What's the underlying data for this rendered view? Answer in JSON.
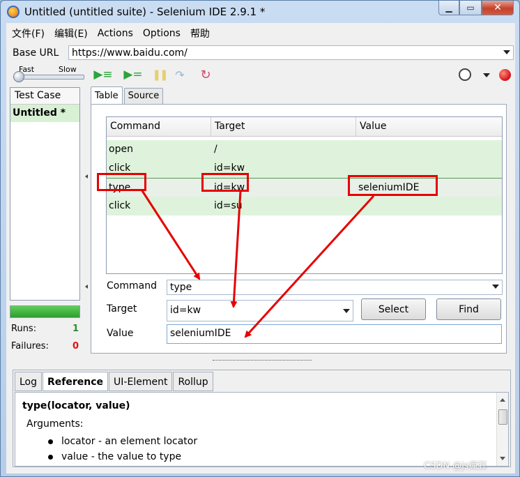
{
  "window": {
    "title": "Untitled (untitled suite) - Selenium IDE 2.9.1 *",
    "min_label": "▁",
    "max_label": "▭",
    "close_label": "✕"
  },
  "menu": [
    "文件(F)",
    "编辑(E)",
    "Actions",
    "Options",
    "帮助"
  ],
  "base_url": {
    "label": "Base URL",
    "value": "https://www.baidu.com/"
  },
  "toolbar": {
    "fast": "Fast",
    "slow": "Slow"
  },
  "test_case": {
    "header": "Test Case",
    "items": [
      "Untitled *"
    ],
    "runs_label": "Runs:",
    "runs_value": "1",
    "failures_label": "Failures:",
    "failures_value": "0",
    "progress": 1.0
  },
  "tabs": [
    "Table",
    "Source"
  ],
  "table": {
    "headers": [
      "Command",
      "Target",
      "Value"
    ],
    "rows": [
      {
        "command": "open",
        "target": "/",
        "value": ""
      },
      {
        "command": "click",
        "target": "id=kw",
        "value": ""
      },
      {
        "command": "type",
        "target": "id=kw",
        "value": "seleniumIDE"
      },
      {
        "command": "click",
        "target": "id=su",
        "value": ""
      }
    ]
  },
  "form": {
    "command_label": "Command",
    "command_value": "type",
    "target_label": "Target",
    "target_value": "id=kw",
    "value_label": "Value",
    "value_value": "seleniumIDE",
    "select_button": "Select",
    "find_button": "Find"
  },
  "bottom_tabs": [
    "Log",
    "Reference",
    "UI-Element",
    "Rollup"
  ],
  "reference": {
    "signature": "type(locator, value)",
    "arguments_label": "Arguments:",
    "arguments": [
      "locator - an element locator",
      "value - the value to type"
    ]
  },
  "watermark": "CSDN @js瘋狂",
  "colors": {
    "annotation": "#e60000",
    "row_bg": "#dff3dc",
    "record": "#d1111a"
  }
}
